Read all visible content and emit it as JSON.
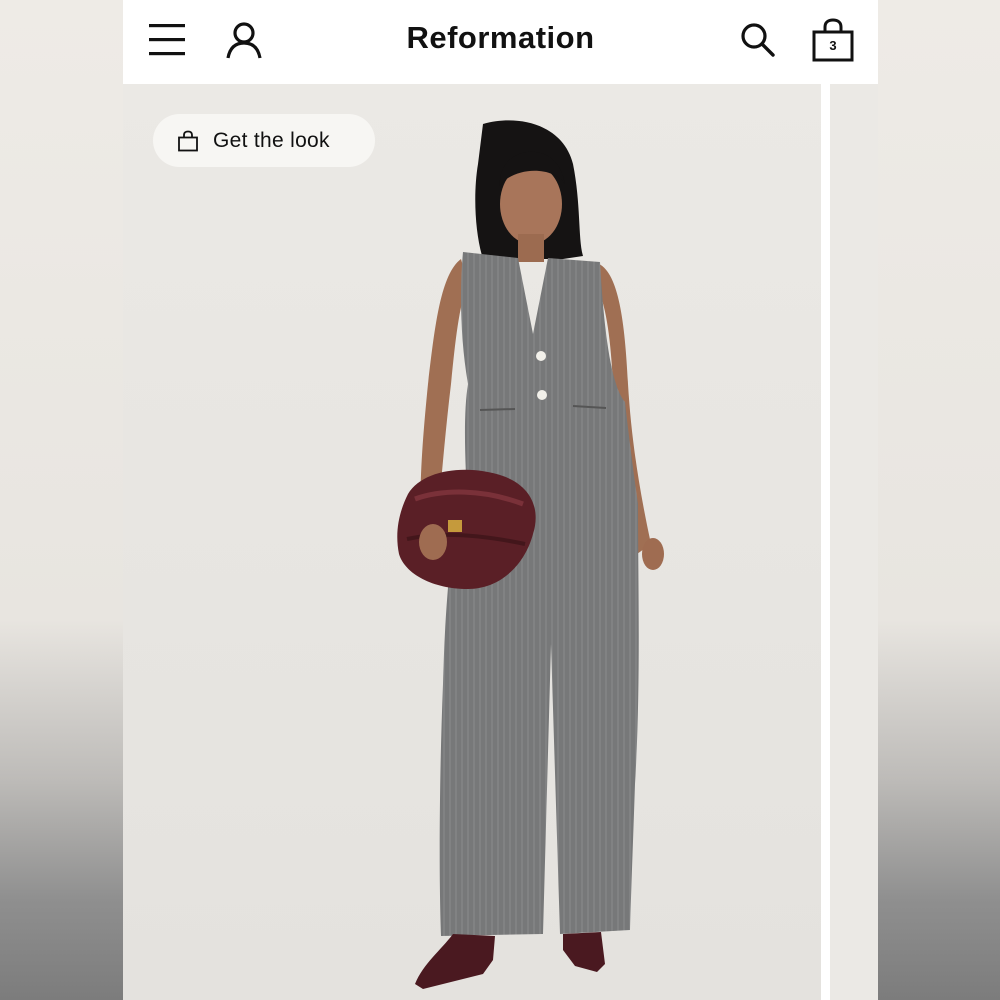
{
  "header": {
    "brand": "Reformation",
    "bag_count": "3",
    "icons": [
      "menu-icon",
      "account-icon",
      "search-icon",
      "shopping-bag-icon"
    ]
  },
  "gallery": {
    "get_the_look_label": "Get the look",
    "get_the_look_icon": "shopping-bag-icon"
  },
  "colors": {
    "header_bg": "#ffffff",
    "text": "#111111",
    "photo_bg": "#e8e6e2",
    "garment_gray": "#7a7b7c",
    "bag_burgundy": "#5a1f26"
  }
}
